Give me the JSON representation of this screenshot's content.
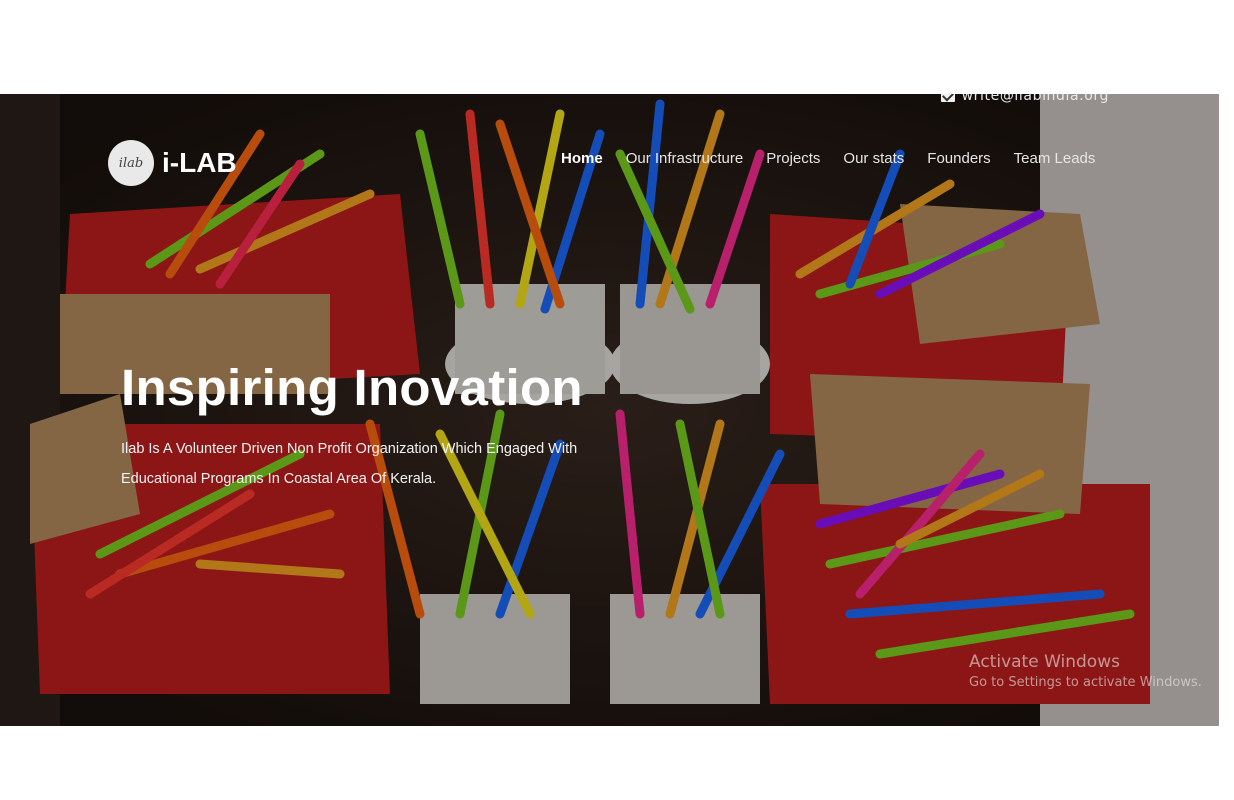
{
  "header": {
    "email": "write@ilabindia.org",
    "logo_badge": "ilab",
    "brand": "i-LAB"
  },
  "nav": {
    "items": [
      "Home",
      "Our Infrastructure",
      "Projects",
      "Our stats",
      "Founders",
      "Team Leads"
    ],
    "active": "Home"
  },
  "hero": {
    "title": "Inspiring Inovation",
    "description": "Ilab Is A Volunteer Driven Non Profit Organization Which Engaged With Educational Programs In Coastal Area Of Kerala."
  },
  "watermark": {
    "line1": "Activate Windows",
    "line2": "Go to Settings to activate Windows."
  }
}
